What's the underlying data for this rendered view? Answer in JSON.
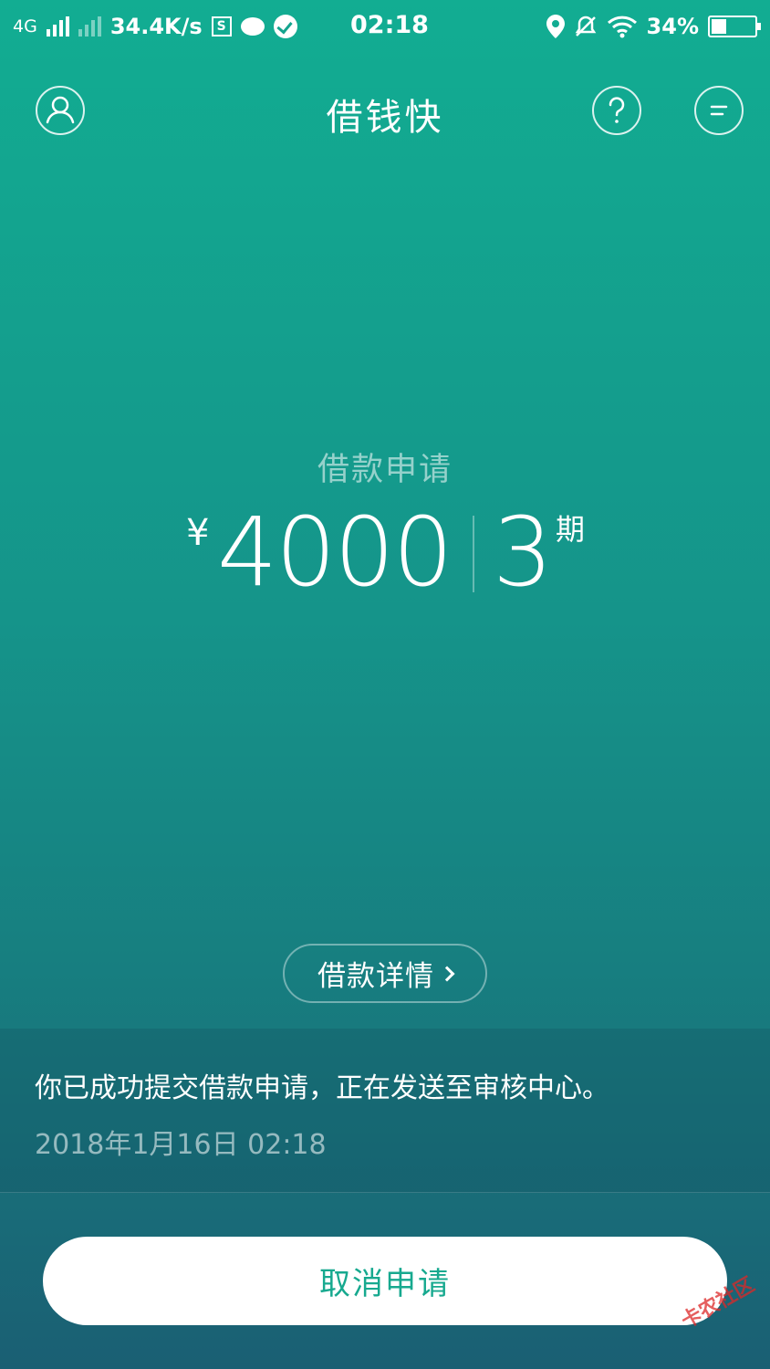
{
  "status_bar": {
    "network": "4G",
    "speed": "34.4K/s",
    "s_icon": "S",
    "time": "02:18",
    "battery": "34%",
    "battery_level": 0.34
  },
  "header": {
    "title": "借钱快",
    "help_icon": "?"
  },
  "loan": {
    "label": "借款申请",
    "currency": "¥",
    "amount": "4000",
    "term": "3",
    "term_unit": "期"
  },
  "details_button": "借款详情",
  "info": {
    "message": "你已成功提交借款申请，正在发送至审核中心。",
    "timestamp": "2018年1月16日 02:18"
  },
  "cancel_button": "取消申请",
  "watermark": "卡农社区",
  "colors": {
    "accent": "#17a98f",
    "gradient_top": "#12ad92",
    "gradient_bottom": "#1a5f73"
  }
}
